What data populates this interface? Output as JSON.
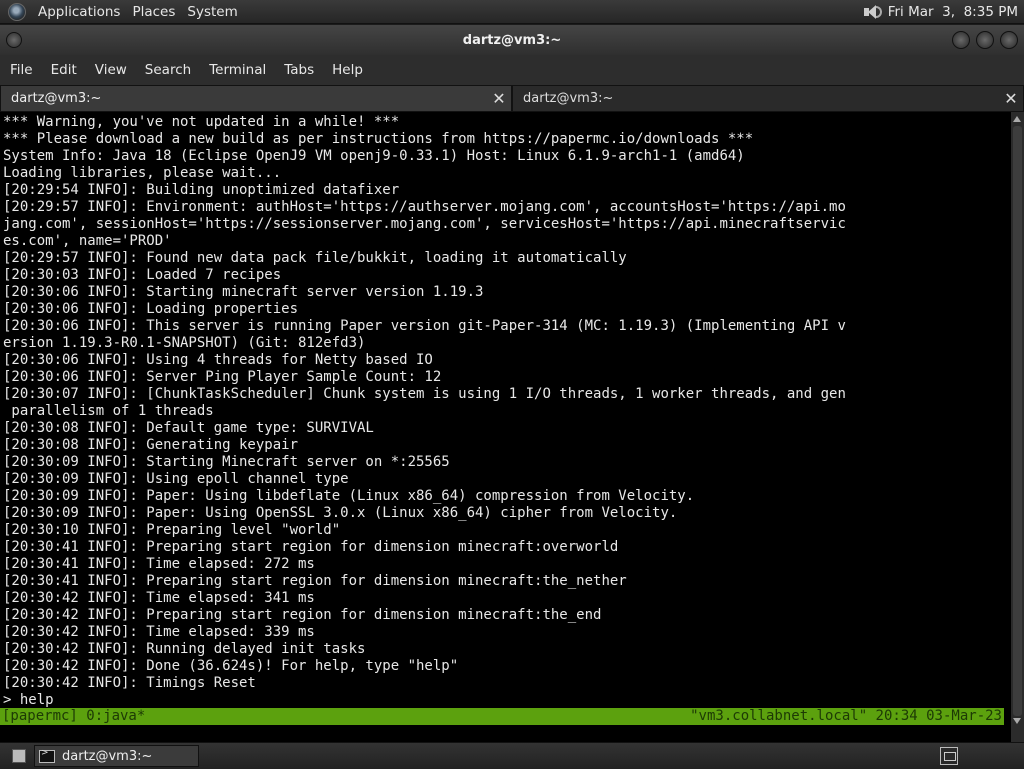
{
  "top_panel": {
    "menus": [
      "Applications",
      "Places",
      "System"
    ],
    "clock": "Fri Mar  3,  8:35 PM"
  },
  "window": {
    "title": "dartz@vm3:~"
  },
  "menubar": [
    "File",
    "Edit",
    "View",
    "Search",
    "Terminal",
    "Tabs",
    "Help"
  ],
  "tabs": [
    {
      "label": "dartz@vm3:~",
      "active": true
    },
    {
      "label": "dartz@vm3:~",
      "active": false
    }
  ],
  "terminal": {
    "lines": [
      "*** Warning, you've not updated in a while! ***",
      "*** Please download a new build as per instructions from https://papermc.io/downloads ***",
      "System Info: Java 18 (Eclipse OpenJ9 VM openj9-0.33.1) Host: Linux 6.1.9-arch1-1 (amd64)",
      "Loading libraries, please wait...",
      "[20:29:54 INFO]: Building unoptimized datafixer",
      "[20:29:57 INFO]: Environment: authHost='https://authserver.mojang.com', accountsHost='https://api.mo",
      "jang.com', sessionHost='https://sessionserver.mojang.com', servicesHost='https://api.minecraftservic",
      "es.com', name='PROD'",
      "[20:29:57 INFO]: Found new data pack file/bukkit, loading it automatically",
      "[20:30:03 INFO]: Loaded 7 recipes",
      "[20:30:06 INFO]: Starting minecraft server version 1.19.3",
      "[20:30:06 INFO]: Loading properties",
      "[20:30:06 INFO]: This server is running Paper version git-Paper-314 (MC: 1.19.3) (Implementing API v",
      "ersion 1.19.3-R0.1-SNAPSHOT) (Git: 812efd3)",
      "[20:30:06 INFO]: Using 4 threads for Netty based IO",
      "[20:30:06 INFO]: Server Ping Player Sample Count: 12",
      "[20:30:07 INFO]: [ChunkTaskScheduler] Chunk system is using 1 I/O threads, 1 worker threads, and gen",
      " parallelism of 1 threads",
      "[20:30:08 INFO]: Default game type: SURVIVAL",
      "[20:30:08 INFO]: Generating keypair",
      "[20:30:09 INFO]: Starting Minecraft server on *:25565",
      "[20:30:09 INFO]: Using epoll channel type",
      "[20:30:09 INFO]: Paper: Using libdeflate (Linux x86_64) compression from Velocity.",
      "[20:30:09 INFO]: Paper: Using OpenSSL 3.0.x (Linux x86_64) cipher from Velocity.",
      "[20:30:10 INFO]: Preparing level \"world\"",
      "[20:30:41 INFO]: Preparing start region for dimension minecraft:overworld",
      "[20:30:41 INFO]: Time elapsed: 272 ms",
      "[20:30:41 INFO]: Preparing start region for dimension minecraft:the_nether",
      "[20:30:42 INFO]: Time elapsed: 341 ms",
      "[20:30:42 INFO]: Preparing start region for dimension minecraft:the_end",
      "[20:30:42 INFO]: Time elapsed: 339 ms",
      "[20:30:42 INFO]: Running delayed init tasks",
      "[20:30:42 INFO]: Done (36.624s)! For help, type \"help\"",
      "[20:30:42 INFO]: Timings Reset",
      "> help"
    ],
    "status_left": "[papermc] 0:java*",
    "status_right": "\"vm3.collabnet.local\" 20:34 03-Mar-23"
  },
  "taskbar": {
    "window_button": "dartz@vm3:~"
  },
  "colors": {
    "status_bar": "#5ca10e",
    "terminal_bg": "#000000"
  }
}
